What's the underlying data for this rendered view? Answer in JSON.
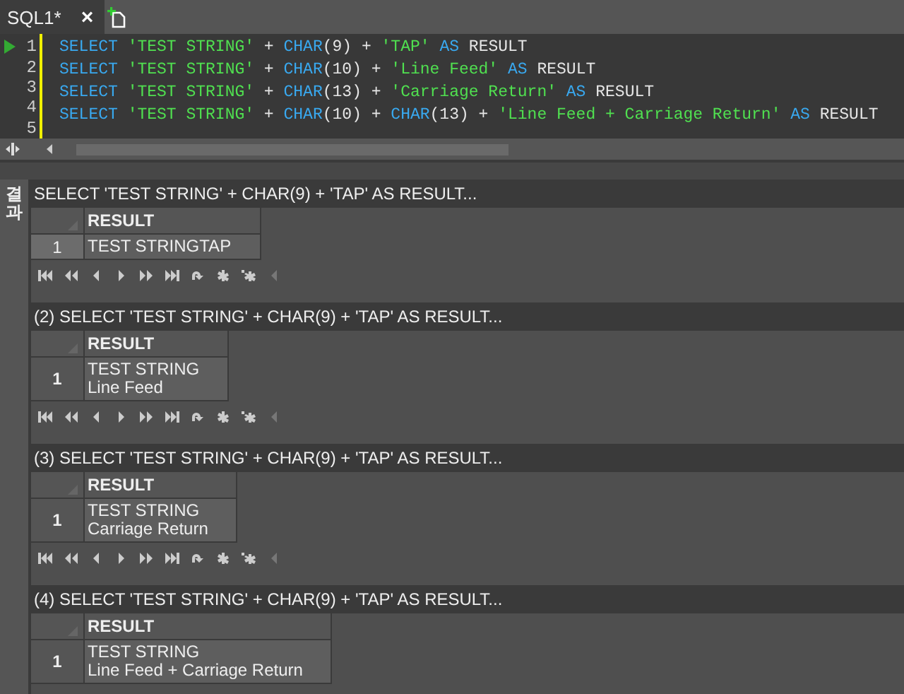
{
  "tabs": [
    {
      "label": "SQL1*",
      "selected": true,
      "close": "×"
    }
  ],
  "editor": {
    "lines": [
      {
        "number": "1",
        "current": true,
        "tokens": [
          {
            "kind": "kw",
            "text": "SELECT "
          },
          {
            "kind": "str",
            "text": "'TEST STRING'"
          },
          {
            "kind": "op",
            "text": " + "
          },
          {
            "kind": "fn",
            "text": "CHAR"
          },
          {
            "kind": "op",
            "text": "(9) + "
          },
          {
            "kind": "str",
            "text": "'TAP'"
          },
          {
            "kind": "kw",
            "text": " AS"
          },
          {
            "kind": "op",
            "text": " RESULT"
          }
        ]
      },
      {
        "number": "2",
        "tokens": [
          {
            "kind": "kw",
            "text": "SELECT "
          },
          {
            "kind": "str",
            "text": "'TEST STRING'"
          },
          {
            "kind": "op",
            "text": " + "
          },
          {
            "kind": "fn",
            "text": "CHAR"
          },
          {
            "kind": "op",
            "text": "(10) + "
          },
          {
            "kind": "str",
            "text": "'Line Feed'"
          },
          {
            "kind": "kw",
            "text": " AS"
          },
          {
            "kind": "op",
            "text": " RESULT"
          }
        ]
      },
      {
        "number": "3",
        "tokens": [
          {
            "kind": "kw",
            "text": "SELECT "
          },
          {
            "kind": "str",
            "text": "'TEST STRING'"
          },
          {
            "kind": "op",
            "text": " + "
          },
          {
            "kind": "fn",
            "text": "CHAR"
          },
          {
            "kind": "op",
            "text": "(13) + "
          },
          {
            "kind": "str",
            "text": "'Carriage Return'"
          },
          {
            "kind": "kw",
            "text": " AS"
          },
          {
            "kind": "op",
            "text": " RESULT"
          }
        ]
      },
      {
        "number": "4",
        "tokens": [
          {
            "kind": "kw",
            "text": "SELECT "
          },
          {
            "kind": "str",
            "text": "'TEST STRING'"
          },
          {
            "kind": "op",
            "text": " + "
          },
          {
            "kind": "fn",
            "text": "CHAR"
          },
          {
            "kind": "op",
            "text": "(10) + "
          },
          {
            "kind": "fn",
            "text": "CHAR"
          },
          {
            "kind": "op",
            "text": "(13) + "
          },
          {
            "kind": "str",
            "text": "'Line Feed + Carriage Return'"
          },
          {
            "kind": "kw",
            "text": " AS"
          },
          {
            "kind": "op",
            "text": " RESULT"
          }
        ]
      },
      {
        "number": "5"
      }
    ]
  },
  "results_tab": "결과",
  "results": [
    {
      "title": "SELECT 'TEST STRING' + CHAR(9) + 'TAP' AS RESULT...",
      "column": "RESULT",
      "rows": [
        {
          "number": "1",
          "selected": true,
          "lines": [
            "TEST STRINGTAP"
          ]
        }
      ]
    },
    {
      "title": "(2) SELECT 'TEST STRING' + CHAR(9) + 'TAP' AS RESULT...",
      "column": "RESULT",
      "rows": [
        {
          "number": "1",
          "selected": false,
          "lines": [
            "TEST STRING",
            "Line Feed"
          ]
        }
      ]
    },
    {
      "title": "(3) SELECT 'TEST STRING' + CHAR(9) + 'TAP' AS RESULT...",
      "column": "RESULT",
      "rows": [
        {
          "number": "1",
          "selected": false,
          "lines": [
            "TEST STRING",
            "Carriage Return"
          ]
        }
      ]
    },
    {
      "title": "(4) SELECT 'TEST STRING' + CHAR(9) + 'TAP' AS RESULT...",
      "column": "RESULT",
      "rows": [
        {
          "number": "1",
          "selected": false,
          "lines": [
            "TEST STRING",
            "Line Feed + Carriage Return"
          ]
        }
      ]
    }
  ]
}
